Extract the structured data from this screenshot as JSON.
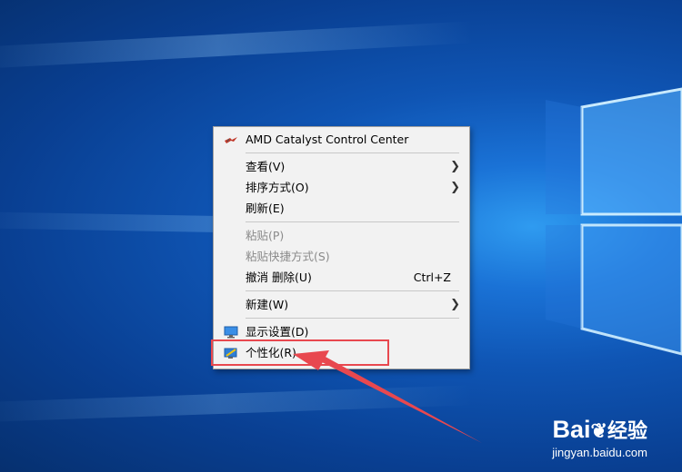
{
  "context_menu": {
    "items": [
      {
        "label": "AMD Catalyst Control Center",
        "icon": "amd-catalyst-icon"
      },
      {
        "label": "查看(V)",
        "submenu": true
      },
      {
        "label": "排序方式(O)",
        "submenu": true
      },
      {
        "label": "刷新(E)"
      },
      {
        "label": "粘贴(P)",
        "disabled": true
      },
      {
        "label": "粘贴快捷方式(S)",
        "disabled": true
      },
      {
        "label": "撤消 删除(U)",
        "shortcut": "Ctrl+Z"
      },
      {
        "label": "新建(W)",
        "submenu": true
      },
      {
        "label": "显示设置(D)",
        "icon": "display-settings-icon"
      },
      {
        "label": "个性化(R)",
        "icon": "personalize-icon"
      }
    ],
    "highlighted_item": "个性化(R)"
  },
  "annotation": {
    "box_color": "#e8484f",
    "arrow_color": "#e8484f"
  },
  "watermark": {
    "brand": "Bai",
    "brand_cn": "经验",
    "url": "jingyan.baidu.com"
  },
  "colors": {
    "desktop_bg": "#0f55b4",
    "menu_bg": "#f2f2f2"
  }
}
